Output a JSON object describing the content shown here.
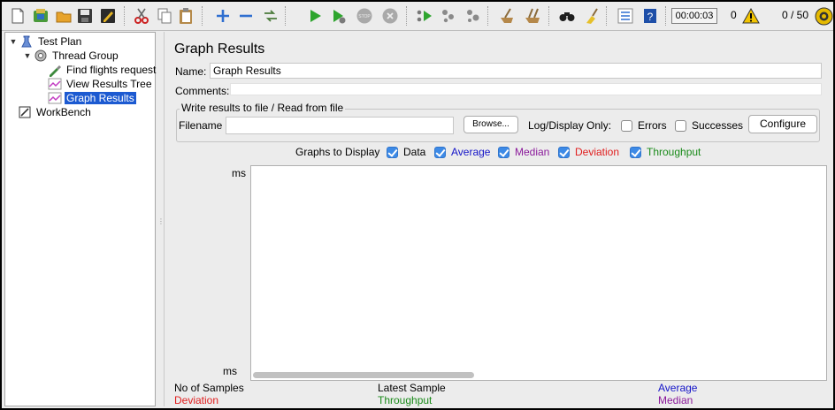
{
  "colors": {
    "data": "#000000",
    "average": "#1414c8",
    "median": "#8b1a9b",
    "deviation": "#e01e1e",
    "throughput": "#198a19",
    "selection": "#1c5ad1"
  },
  "toolbar": {
    "icons": [
      "new-icon",
      "templates-icon",
      "open-icon",
      "save-icon",
      "save-as-icon",
      "cut-icon",
      "copy-icon",
      "paste-icon",
      "expand-icon",
      "collapse-icon",
      "toggle-icon",
      "start-icon",
      "start-no-pause-icon",
      "stop-icon",
      "shutdown-icon",
      "remote-start-icon",
      "remote-stop-icon",
      "remote-shutdown-icon",
      "clear-icon",
      "clear-all-icon",
      "search-icon",
      "reset-search-icon",
      "function-helper-icon",
      "help-icon"
    ],
    "timer": "00:00:03",
    "error_count": "0",
    "threads": "0 / 50"
  },
  "tree": {
    "items": [
      {
        "label": "Test Plan",
        "icon": "test-plan-icon"
      },
      {
        "label": "Thread Group",
        "icon": "thread-group-icon"
      },
      {
        "label": "Find flights request",
        "icon": "sampler-icon"
      },
      {
        "label": "View Results Tree",
        "icon": "listener-icon"
      },
      {
        "label": "Graph Results",
        "icon": "listener-icon"
      },
      {
        "label": "WorkBench",
        "icon": "workbench-icon"
      }
    ]
  },
  "panel": {
    "title": "Graph Results",
    "name_label": "Name:",
    "name_value": "Graph Results",
    "comments_label": "Comments:",
    "comments_value": "",
    "file_group_title": "Write results to file / Read from file",
    "filename_label": "Filename",
    "filename_value": "",
    "browse_label": "Browse...",
    "log_display_label": "Log/Display Only:",
    "errors_label": "Errors",
    "errors_checked": false,
    "successes_label": "Successes",
    "successes_checked": false,
    "configure_label": "Configure",
    "graphs_to_display_label": "Graphs to Display",
    "graphs": [
      {
        "label": "Data",
        "checked": true
      },
      {
        "label": "Average",
        "checked": true
      },
      {
        "label": "Median",
        "checked": true
      },
      {
        "label": "Deviation",
        "checked": true
      },
      {
        "label": "Throughput",
        "checked": true
      }
    ],
    "y_top_label": "ms",
    "y_bottom_label": "ms",
    "footer": {
      "no_of_samples": "No of Samples",
      "latest_sample": "Latest Sample",
      "average": "Average",
      "deviation": "Deviation",
      "throughput": "Throughput",
      "median": "Median"
    }
  }
}
